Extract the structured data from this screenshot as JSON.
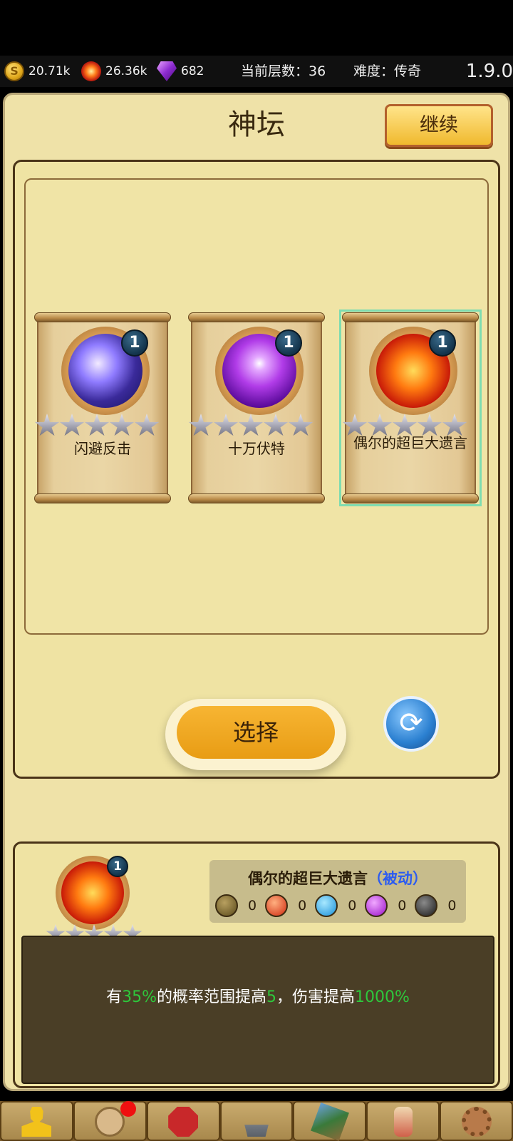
{
  "resources": {
    "gold": "20.71k",
    "fire": "26.36k",
    "gems": "682",
    "floor": "当前层数：36",
    "difficulty": "难度：传奇",
    "version": "1.9.0"
  },
  "header": {
    "title": "神坛",
    "continue_label": "继续"
  },
  "cards": [
    {
      "name": "闪避反击",
      "level": "1",
      "stars": 5,
      "icon": "dodge-counter-icon"
    },
    {
      "name": "十万伏特",
      "level": "1",
      "stars": 5,
      "icon": "lightning-icon"
    },
    {
      "name": "偶尔的超巨大遗言",
      "level": "1",
      "stars": 5,
      "icon": "skeleton-explosion-icon",
      "selected": true
    }
  ],
  "actions": {
    "select_label": "选择",
    "refresh_icon": "refresh-icon"
  },
  "detail": {
    "name": "偶尔的超巨大遗言",
    "type": "（被动）",
    "level": "1",
    "elements": [
      {
        "color": "#6b5a2a",
        "count": "0"
      },
      {
        "color": "#e0401a",
        "count": "0"
      },
      {
        "color": "#28a8e8",
        "count": "0"
      },
      {
        "color": "#b41ad8",
        "count": "0"
      },
      {
        "color": "#3a3a3a",
        "count": "0"
      }
    ],
    "desc_parts": [
      "有",
      "35%",
      "的概率范围提高",
      "5",
      "，伤害提高",
      "1000%"
    ]
  },
  "bottom_nav": [
    {
      "icon": "hero-icon"
    },
    {
      "icon": "pet-icon",
      "notify": true
    },
    {
      "icon": "equipment-icon"
    },
    {
      "icon": "forge-icon"
    },
    {
      "icon": "map-icon"
    },
    {
      "icon": "scroll-icon"
    },
    {
      "icon": "settings-gear-icon"
    }
  ]
}
